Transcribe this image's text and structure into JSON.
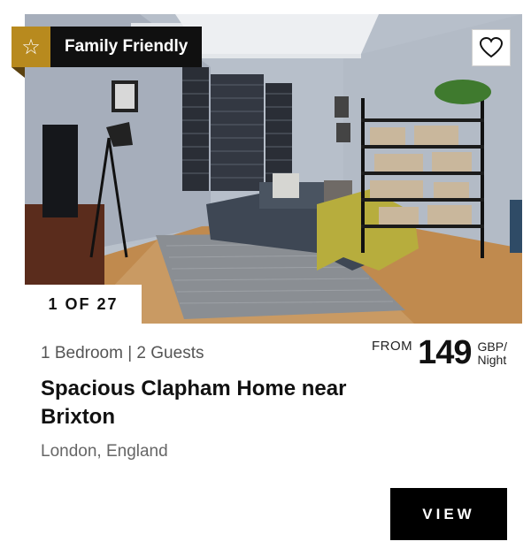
{
  "listing": {
    "badge_label": "Family Friendly",
    "badge_icon": "star-icon",
    "photo_counter": "1 OF 27",
    "meta": "1 Bedroom | 2 Guests",
    "price_prefix": "FROM",
    "price_amount": "149",
    "price_currency": "GBP/",
    "price_period": "Night",
    "title": "Spacious Clapham Home near Brixton",
    "location": "London, England",
    "view_label": "VIEW",
    "favorite_icon": "heart-icon"
  },
  "colors": {
    "badge_accent": "#b88a1e",
    "badge_dark": "#101010",
    "button_bg": "#000000"
  }
}
